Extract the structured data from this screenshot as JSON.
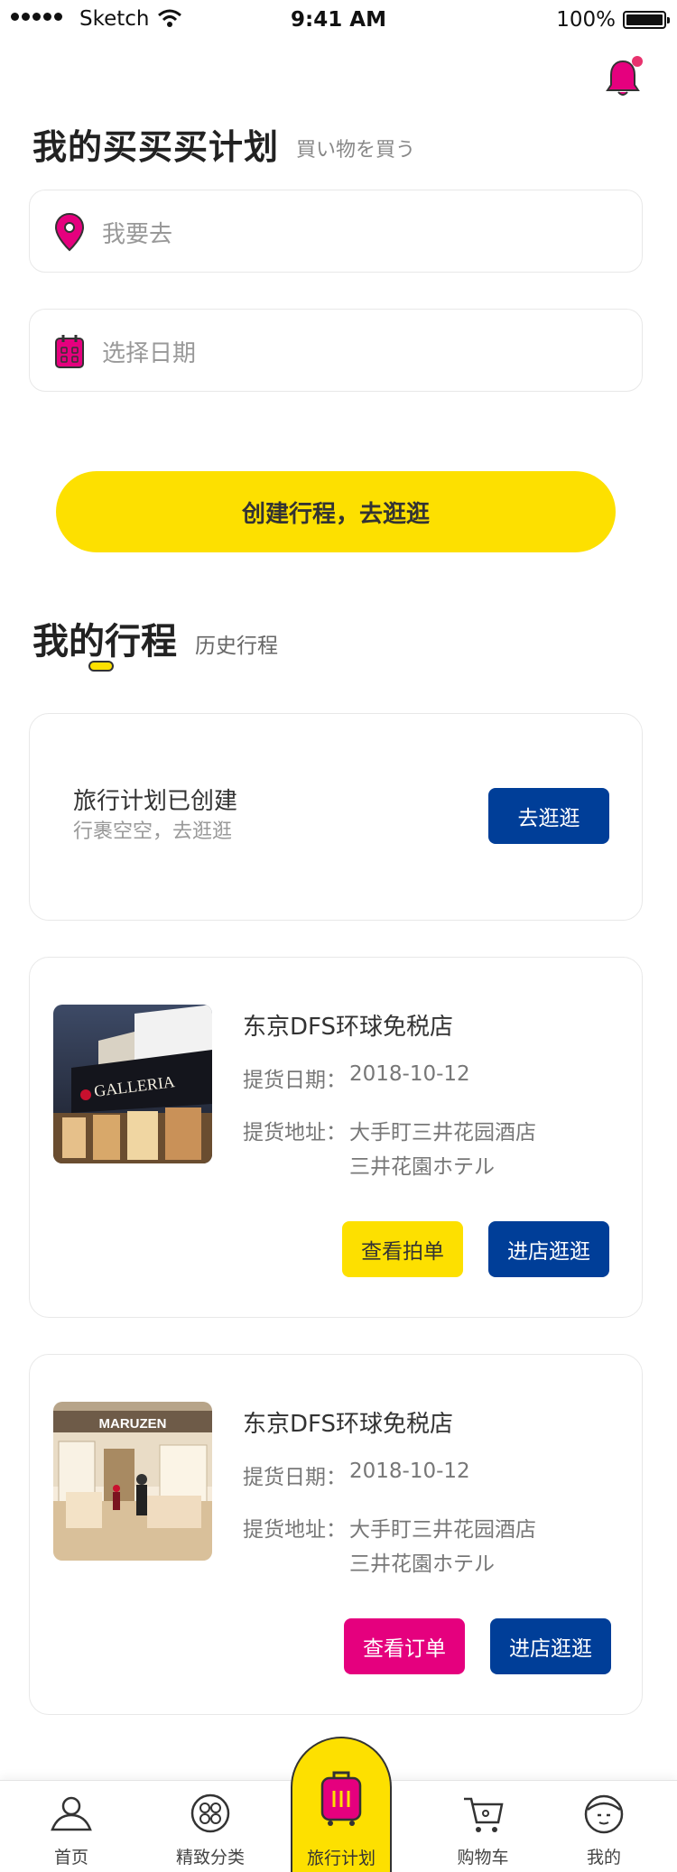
{
  "status_bar": {
    "carrier": "Sketch",
    "time": "9:41 AM",
    "battery": "100%"
  },
  "header": {
    "title": "我的买买买计划",
    "subtitle": "買い物を買う"
  },
  "form": {
    "destination_placeholder": "我要去",
    "date_placeholder": "选择日期"
  },
  "create_button": "创建行程，去逛逛",
  "my_trips": {
    "title": "我的行程",
    "history": "历史行程"
  },
  "empty_trip": {
    "title": "旅行计划已创建",
    "subtitle": "行裹空空，去逛逛",
    "button": "去逛逛"
  },
  "trips": [
    {
      "store": "东京DFS环球免税店",
      "date_label": "提货日期：",
      "date": "2018-10-12",
      "address_label": "提货地址：",
      "address_line1": "大手盯三井花园酒店",
      "address_line2": "三井花園ホテル",
      "primary_button": "查看拍单",
      "secondary_button": "进店逛逛",
      "image_sign": "GALLERIA"
    },
    {
      "store": "东京DFS环球免税店",
      "date_label": "提货日期：",
      "date": "2018-10-12",
      "address_label": "提货地址：",
      "address_line1": "大手盯三井花园酒店",
      "address_line2": "三井花園ホテル",
      "primary_button": "查看订单",
      "secondary_button": "进店逛逛",
      "image_sign": "MARUZEN"
    }
  ],
  "tabbar": {
    "home": "首页",
    "category": "精致分类",
    "travel": "旅行计划",
    "cart": "购物车",
    "me": "我的"
  },
  "colors": {
    "accent_yellow": "#fde000",
    "brand_blue": "#003e98",
    "brand_pink": "#e5007e",
    "notification": "#e8326e"
  },
  "icons": [
    "bell-icon",
    "location-pin-icon",
    "calendar-icon",
    "home-icon",
    "category-icon",
    "suitcase-icon",
    "cart-icon",
    "profile-icon"
  ]
}
